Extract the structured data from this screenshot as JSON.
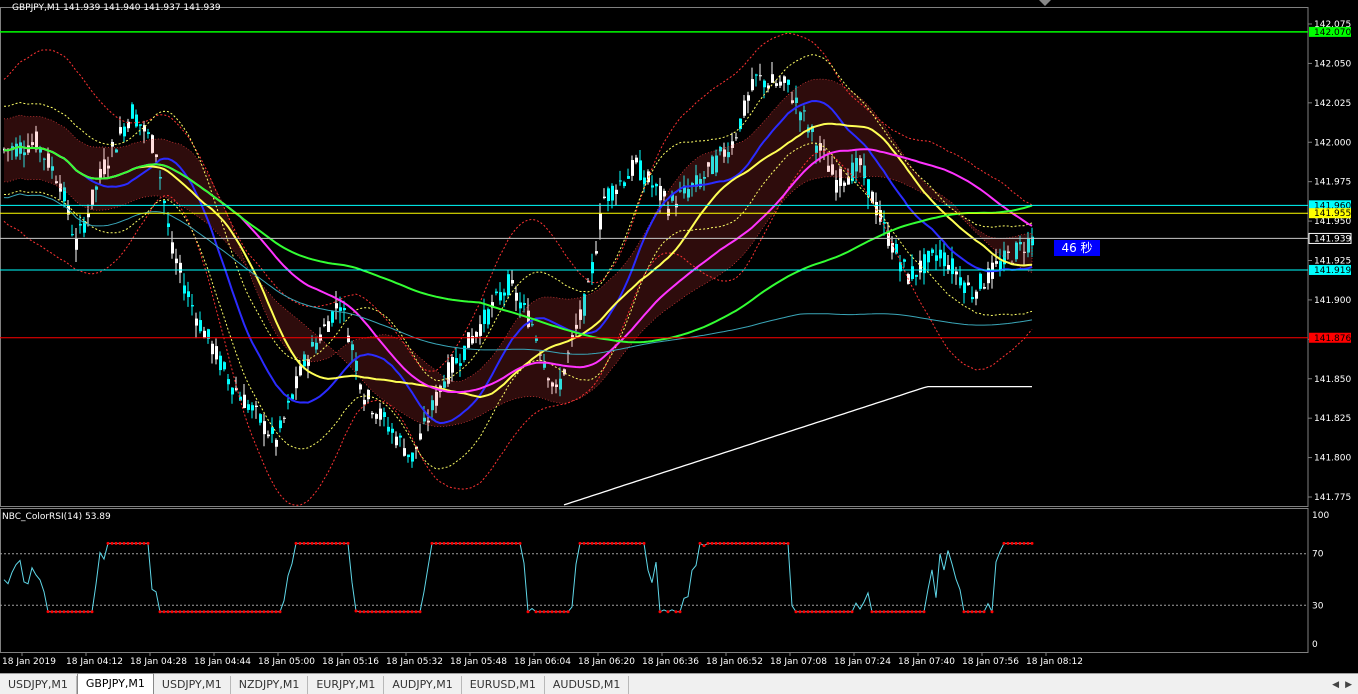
{
  "header": {
    "symbol_info": "GBPJPY,M1  141.939 141.940 141.937 141.939"
  },
  "countdown": {
    "text": "46 秒"
  },
  "price_axis": {
    "ticks": [
      "142.075",
      "142.050",
      "142.025",
      "142.000",
      "141.975",
      "141.950",
      "141.925",
      "141.900",
      "141.875",
      "141.850",
      "141.825",
      "141.800",
      "141.775"
    ],
    "labels": [
      {
        "text": "142.070",
        "color": "#00ff00",
        "value": 142.07
      },
      {
        "text": "141.960",
        "color": "#00ffff",
        "value": 141.96
      },
      {
        "text": "141.955",
        "color": "#ffff00",
        "value": 141.955
      },
      {
        "text": "141.939",
        "color": "#ffffff",
        "value": 141.939
      },
      {
        "text": "141.919",
        "color": "#00ffff",
        "value": 141.919
      },
      {
        "text": "141.876",
        "color": "#ff0000",
        "value": 141.876
      }
    ]
  },
  "horizontal_lines": [
    {
      "value": 142.07,
      "color": "#00ff00"
    },
    {
      "value": 141.96,
      "color": "#00ffff"
    },
    {
      "value": 141.955,
      "color": "#ffff00"
    },
    {
      "value": 141.939,
      "color": "#c8c8c8"
    },
    {
      "value": 141.919,
      "color": "#00ffff"
    },
    {
      "value": 141.876,
      "color": "#ff0000"
    }
  ],
  "time_axis": {
    "labels": [
      "18 Jan 2019",
      "18 Jan 04:12",
      "18 Jan 04:28",
      "18 Jan 04:44",
      "18 Jan 05:00",
      "18 Jan 05:16",
      "18 Jan 05:32",
      "18 Jan 05:48",
      "18 Jan 06:04",
      "18 Jan 06:20",
      "18 Jan 06:36",
      "18 Jan 06:52",
      "18 Jan 07:08",
      "18 Jan 07:24",
      "18 Jan 07:40",
      "18 Jan 07:56",
      "18 Jan 08:12"
    ]
  },
  "rsi": {
    "title": "NBC_ColorRSI(14) 53.89",
    "levels": [
      "100",
      "70",
      "30",
      "0"
    ],
    "colors": {
      "line": "#5fd7e8",
      "overbought": "#ff0000",
      "oversold": "#ff0000"
    }
  },
  "colors": {
    "candle": "#00ffff",
    "ma_blue": "#2b2bff",
    "ma_yellow": "#ffff55",
    "ma_magenta": "#ff33ff",
    "ma_green": "#33ff33",
    "ma_teal": "#3aa6b8",
    "ma_white": "#ffffff",
    "bands_red": "#ff3333",
    "bands_yellow": "#ffff66",
    "cloud_red": "#ff4444",
    "cloud_blue": "#4455ff"
  },
  "tabs": [
    {
      "label": "USDJPY,M1",
      "active": false
    },
    {
      "label": "GBPJPY,M1",
      "active": true
    },
    {
      "label": "USDJPY,M1",
      "active": false
    },
    {
      "label": "NZDJPY,M1",
      "active": false
    },
    {
      "label": "EURJPY,M1",
      "active": false
    },
    {
      "label": "AUDJPY,M1",
      "active": false
    },
    {
      "label": "EURUSD,M1",
      "active": false
    },
    {
      "label": "AUDUSD,M1",
      "active": false
    }
  ]
}
